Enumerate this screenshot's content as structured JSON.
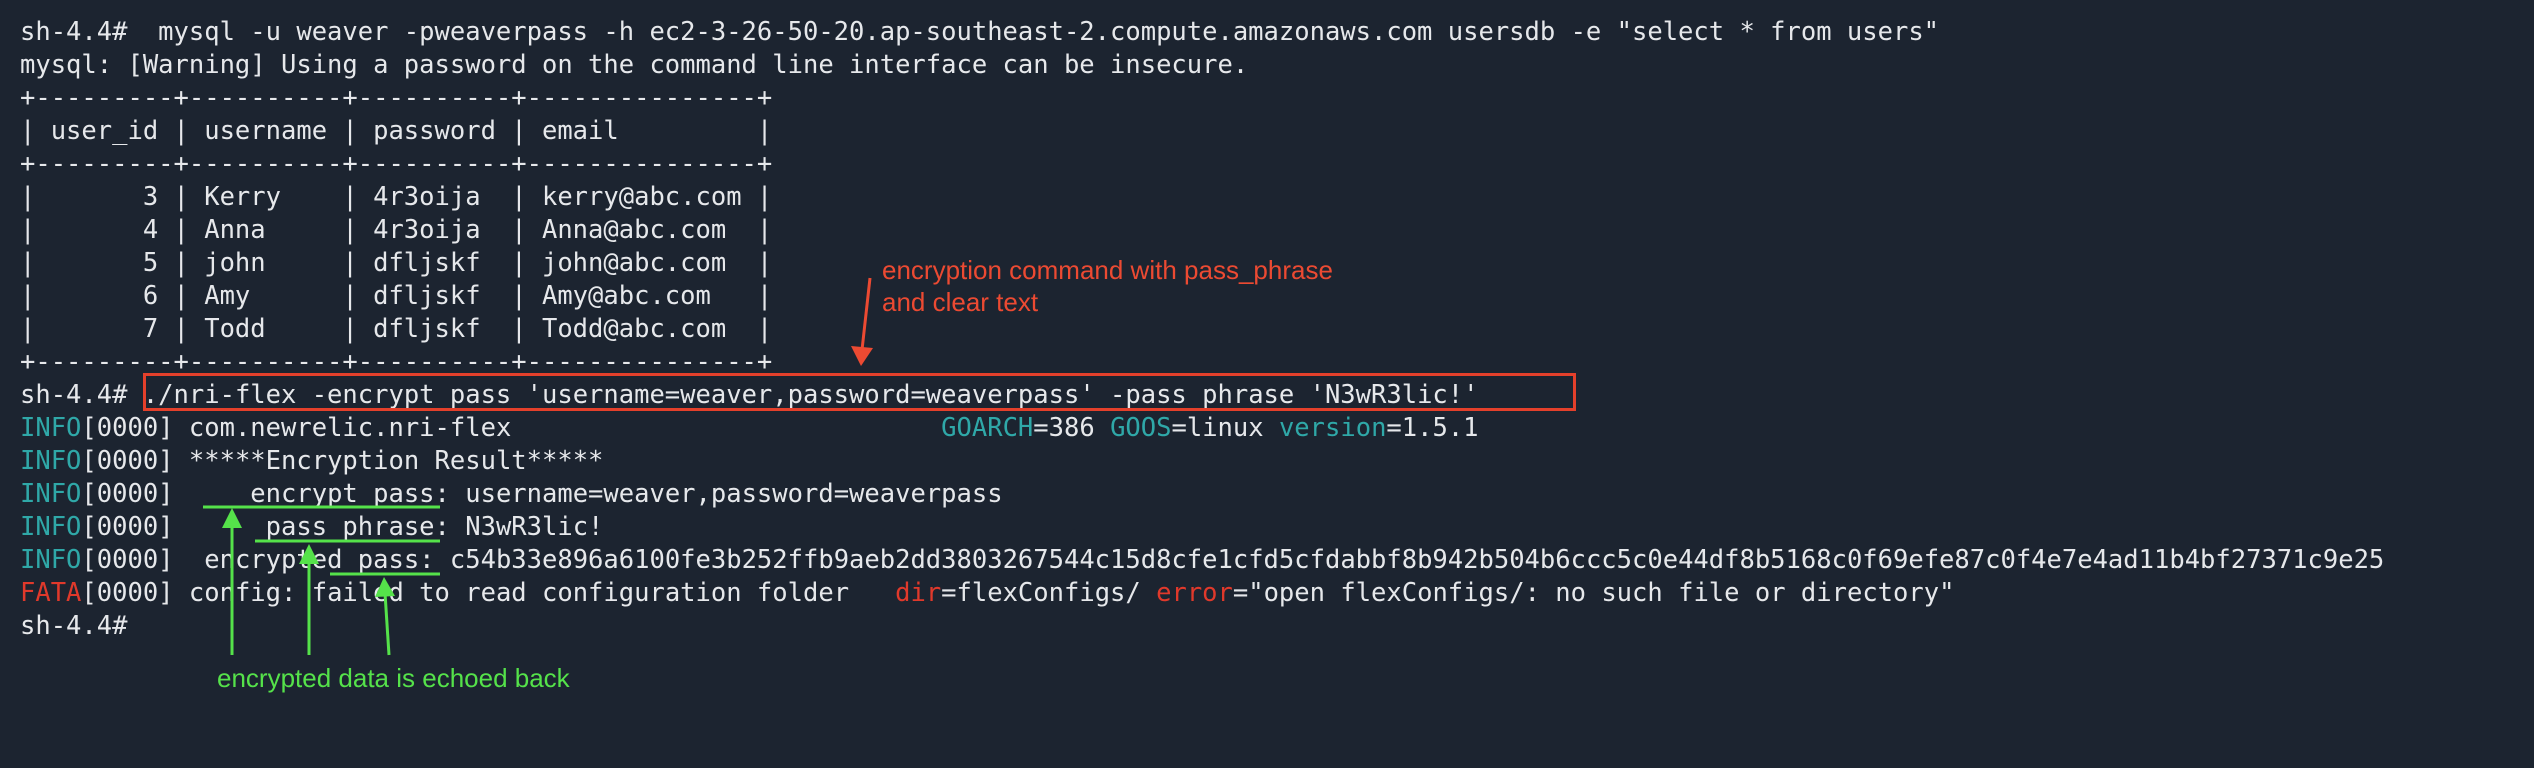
{
  "terminal": {
    "lines": [
      "sh-4.4#  mysql -u weaver -pweaverpass -h ec2-3-26-50-20.ap-southeast-2.compute.amazonaws.com usersdb -e \"select * from users\"",
      "mysql: [Warning] Using a password on the command line interface can be insecure.",
      "+---------+----------+----------+---------------+",
      "| user_id | username | password | email         |",
      "+---------+----------+----------+---------------+",
      "|       3 | Kerry    | 4r3oija  | kerry@abc.com |",
      "|       4 | Anna     | 4r3oija  | Anna@abc.com  |",
      "|       5 | john     | dfljskf  | john@abc.com  |",
      "|       6 | Amy      | dfljskf  | Amy@abc.com   |",
      "|       7 | Todd     | dfljskf  | Todd@abc.com  |",
      "+---------+----------+----------+---------------+"
    ],
    "flex_prompt": "sh-4.4# ",
    "flex_command": "./nri-flex -encrypt_pass 'username=weaver,password=weaverpass' -pass_phrase 'N3wR3lic!'",
    "info_tag": "INFO",
    "fata_tag": "FATA",
    "code": "[0000]",
    "info1_text": " com.newrelic.nri-flex                            ",
    "info1_k1": "GOARCH",
    "info1_v1": "=386 ",
    "info1_k2": "GOOS",
    "info1_v2": "=linux ",
    "info1_k3": "version",
    "info1_v3": "=1.5.1",
    "info2_text": " *****Encryption Result*****",
    "info3_text": "     encrypt_pass: username=weaver,password=weaverpass",
    "info4_text": "      pass_phrase: N3wR3lic!",
    "info5_text": "  encrypted_pass: c54b33e896a6100fe3b252ffb9aeb2dd3803267544c15d8cfe1cfd5cfdabbf8b942b504b6ccc5c0e44df8b5168c0f69efe87c0f4e7e4ad11b4bf27371c9e25",
    "fata_text": " config: failed to read configuration folder   ",
    "fata_k1": "dir",
    "fata_v1": "=flexConfigs/ ",
    "fata_k2": "error",
    "fata_v2": "=\"open flexConfigs/: no such file or directory\"",
    "final_prompt": "sh-4.4#"
  },
  "annotations": {
    "red_note_line1": "encryption command with pass_phrase",
    "red_note_line2": "and clear text",
    "green_note": "encrypted data is echoed back"
  },
  "colors": {
    "background": "#1c2430",
    "text": "#e6e8eb",
    "info": "#2fa8a8",
    "fata": "#e0392b",
    "annotation_red": "#ec4a32",
    "annotation_green": "#55e24a"
  }
}
